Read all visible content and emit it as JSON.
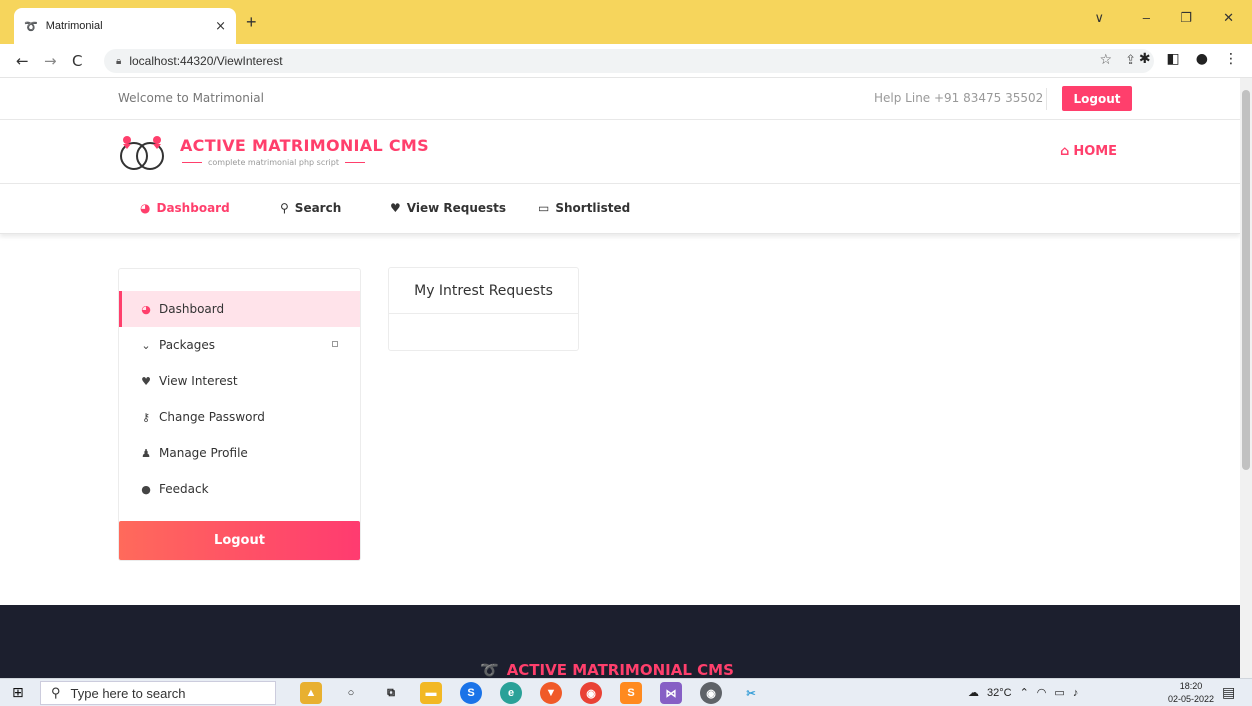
{
  "browser": {
    "tab_title": "Matrimonial",
    "tab_favicon": "rings-favicon",
    "tab_close": "×",
    "new_tab": "+",
    "url": "localhost:44320/ViewInterest",
    "window_controls": {
      "dropdown": "∨",
      "minimize": "–",
      "maximize": "❐",
      "close": "✕"
    },
    "nav": {
      "back": "←",
      "forward": "→",
      "reload": "C"
    }
  },
  "topbar": {
    "welcome": "Welcome to Matrimonial",
    "helpline": "Help Line +91 83475 35502",
    "logout": "Logout"
  },
  "brand": {
    "name": "ACTIVE MATRIMONIAL CMS",
    "tagline": "complete matrimonial php script",
    "home": "HOME",
    "accent": "#ff3f6c"
  },
  "menu": {
    "items": [
      {
        "label": "Dashboard",
        "icon": "dashboard-icon",
        "active": true
      },
      {
        "label": "Search",
        "icon": "search-icon",
        "active": false
      },
      {
        "label": "View Requests",
        "icon": "heart-icon",
        "active": false
      },
      {
        "label": "Shortlisted",
        "icon": "laptop-icon",
        "active": false
      }
    ]
  },
  "sidebar": {
    "items": [
      {
        "label": "Dashboard",
        "icon": "dashboard-icon"
      },
      {
        "label": "Packages",
        "icon": "chevron-down-icon"
      },
      {
        "label": "View Interest",
        "icon": "heart-icon"
      },
      {
        "label": "Change Password",
        "icon": "key-icon"
      },
      {
        "label": "Manage Profile",
        "icon": "user-icon"
      },
      {
        "label": "Feedack",
        "icon": "comment-icon"
      }
    ],
    "logout": "Logout"
  },
  "content": {
    "card_title": "My Intrest Requests"
  },
  "footer": {
    "brand": "ACTIVE MATRIMONIAL CMS"
  },
  "taskbar": {
    "search_placeholder": "Type here to search",
    "temperature": "32°C",
    "time": "18:20",
    "date": "02-05-2022"
  }
}
